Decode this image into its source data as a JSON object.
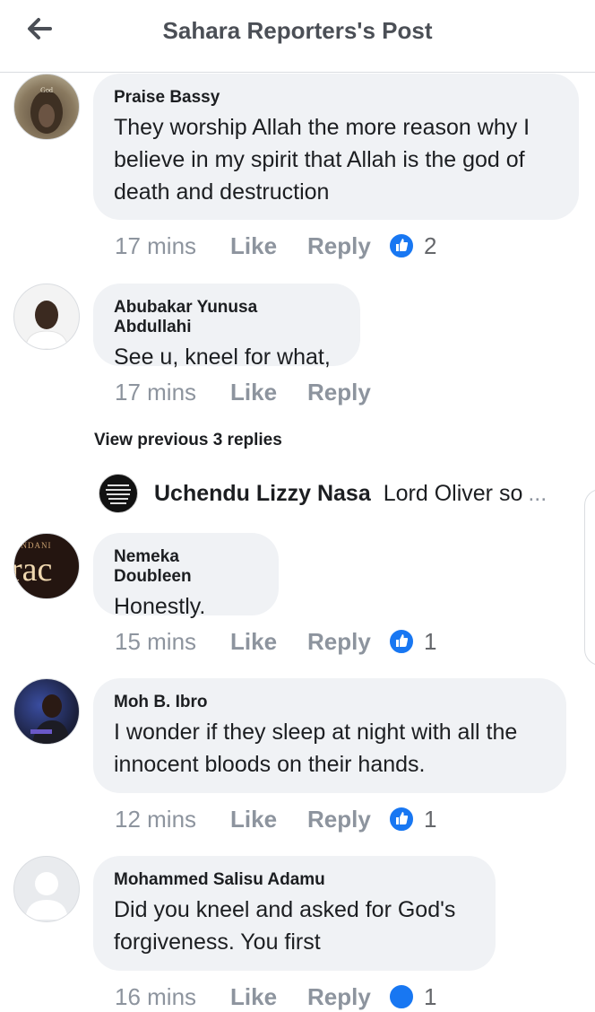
{
  "header": {
    "title": "Sahara Reporters's Post",
    "back_icon": "arrow-left-icon"
  },
  "comments": [
    {
      "author": "Praise Bassy",
      "avatar_label": "God",
      "text": "They worship Allah the more reason why I believe in my spirit that Allah is the god of death and destruction",
      "time": "17 mins",
      "like_label": "Like",
      "reply_label": "Reply",
      "reactions": "2"
    },
    {
      "author": "Abubakar Yunusa Abdullahi",
      "text": "See u, kneel for what,",
      "time": "17 mins",
      "like_label": "Like",
      "reply_label": "Reply"
    },
    {
      "author": "Nemeka Doubleen",
      "avatar_label": "rac",
      "avatar_small_label": "SUNDANI",
      "text": "Honestly.",
      "time": "15 mins",
      "like_label": "Like",
      "reply_label": "Reply",
      "reactions": "1"
    },
    {
      "author": "Moh B. Ibro",
      "text": "I wonder if they sleep at night with all the innocent bloods on their hands.",
      "time": "12 mins",
      "like_label": "Like",
      "reply_label": "Reply",
      "reactions": "1"
    },
    {
      "author": "Mohammed Salisu Adamu",
      "text": "Did you kneel and asked for God's forgiveness. You first",
      "time": "16 mins",
      "like_label": "Like",
      "reply_label": "Reply",
      "reactions": "1"
    }
  ],
  "replies": {
    "view_previous": "View previous 3 replies",
    "preview": {
      "author": "Uchendu Lizzy Nasa",
      "text": "Lord Oliver so",
      "ellipsis": "..."
    }
  },
  "colors": {
    "bubble": "#f0f2f5",
    "meta": "#8d949e",
    "like_blue": "#1877f2"
  }
}
